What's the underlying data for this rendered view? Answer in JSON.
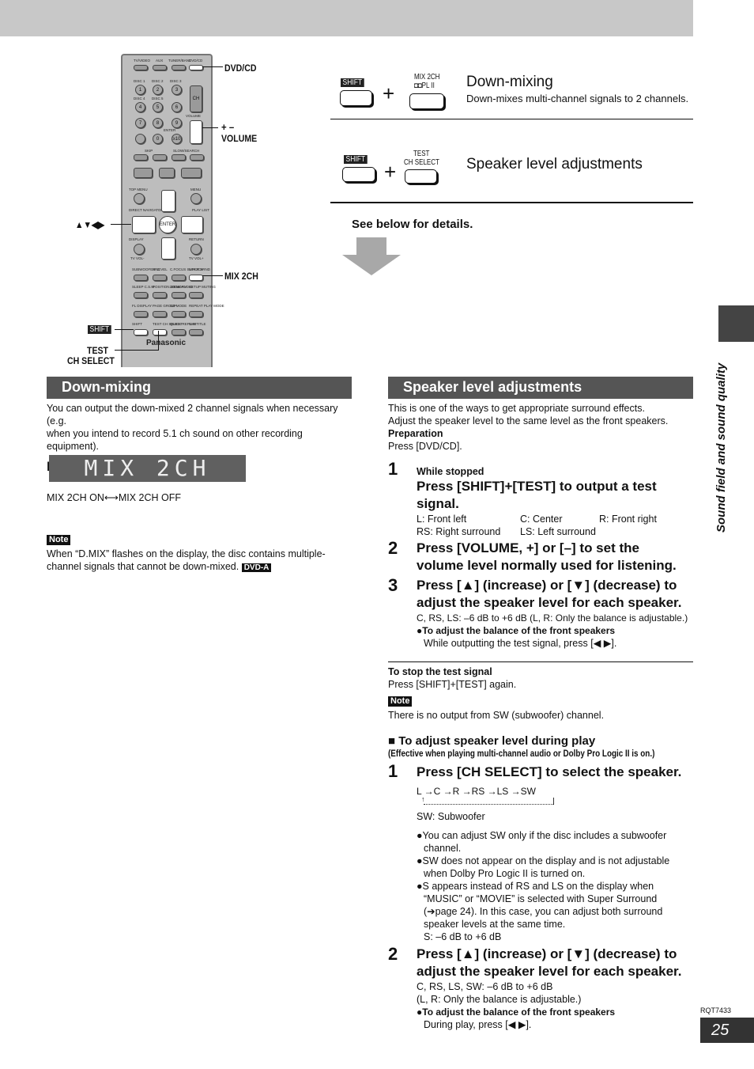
{
  "remote": {
    "labels": {
      "tvvideo": "TV/VIDEO",
      "aux": "AUX",
      "tuner": "TUNER/BAND",
      "dvdcd": "DVD/CD",
      "disc1": "DISC 1",
      "disc2": "DISC 2",
      "disc3": "DISC 3",
      "disc4": "DISC 4",
      "disc5": "DISC 5",
      "n1": "1",
      "n2": "2",
      "n3": "3",
      "n4": "4",
      "n5": "5",
      "n6": "6",
      "n7": "7",
      "n8": "8",
      "n9": "9",
      "cancel": "CANCEL",
      "n0": "0",
      "n10": "≥10",
      "ch": "CH",
      "volume": "VOLUME",
      "enter": "ENTER",
      "skip": "SKIP",
      "slow": "SLOW/SEARCH",
      "topmenu": "TOP MENU",
      "menu": "MENU",
      "direct": "DIRECT NAVIGATOR",
      "play": "PLAY LIST",
      "display": "DISPLAY",
      "return": "RETURN",
      "tvvolm": "TV VOL-",
      "tvvolp": "TV VOL+",
      "subwoofer": "SUBWOOFER LEVEL",
      "sfc": "SFC",
      "cfocus": "C.FOCUS SUPER SRND",
      "mix2ch": "MIX 2CH",
      "sleep": "SLEEP C.S.M",
      "position": "POSITION MEMORY",
      "zoom": "ZOOM AUDIO",
      "setup": "SETUP MUTING",
      "fldisplay": "FL DISPLAY",
      "page": "PAGE GROUP",
      "cdmode": "CD MODE",
      "repeat": "REPEAT PLAY MODE",
      "shift": "SHIFT",
      "test": "TEST CH SELECT",
      "quick": "QUICK REPLAY",
      "subtitle": "SUBTITLE",
      "brand": "Panasonic"
    },
    "callouts": {
      "dvdcd": "DVD/CD",
      "plusminus": "+ –",
      "volume": "VOLUME",
      "arrows": "▲▼◀▶",
      "mix2ch": "MIX 2CH",
      "shift": "SHIFT",
      "test": "TEST",
      "chselect": "CH SELECT"
    }
  },
  "summary": {
    "row1": {
      "shift": "SHIFT",
      "key_top": "MIX 2CH",
      "key_bottom": "◘◘PL II",
      "plus": "+",
      "title": "Down-mixing",
      "desc": "Down-mixes multi-channel signals to 2 channels."
    },
    "row2": {
      "shift": "SHIFT",
      "key_top": "TEST",
      "key_bottom": "CH SELECT",
      "plus": "+",
      "title": "Speaker level adjustments"
    },
    "see_below": "See below for details."
  },
  "side_tab": "Sound field and sound quality",
  "downmix": {
    "heading": "Down-mixing",
    "intro": [
      "You can output the down-mixed 2 channel signals when necessary (e.g.",
      "when you intend to record 5.1 ch sound on other recording equipment)."
    ],
    "press": "Press [SHIFT]+[MIX 2CH].",
    "display": "MIX 2CH",
    "toggle": "MIX 2CH ON⟷MIX 2CH OFF",
    "note_label": "Note",
    "note": [
      "When “D.MIX” flashes on the display, the disc contains multiple-",
      "channel signals that cannot be down-mixed."
    ],
    "badge": "DVD-A"
  },
  "speaker": {
    "heading": "Speaker level adjustments",
    "intro": [
      "This is one of the ways to get appropriate surround effects.",
      "Adjust the speaker level to the same level as the front speakers."
    ],
    "prep_label": "Preparation",
    "prep": "Press [DVD/CD].",
    "steps": [
      {
        "num": "1",
        "pre": "While stopped",
        "title": [
          "Press [SHIFT]+[TEST] to output a test",
          "signal."
        ],
        "legend": [
          [
            "L:  Front left",
            "C:  Center",
            "R:  Front right"
          ],
          [
            "RS:  Right surround",
            "LS:  Left surround",
            ""
          ]
        ]
      },
      {
        "num": "2",
        "title": [
          "Press [VOLUME, +] or [–] to set the",
          "volume level normally used for listening."
        ]
      },
      {
        "num": "3",
        "title": [
          "Press [▲] (increase) or [▼] (decrease) to",
          "adjust the speaker level for each speaker."
        ],
        "range": "C, RS, LS:  –6 dB to +6 dB (L, R: Only the balance is adjustable.)",
        "bullet": "●To adjust the balance of the front speakers",
        "bullet_text": "While outputting the test signal, press [◀ ▶]."
      }
    ],
    "stop_label": "To stop the test signal",
    "stop": "Press [SHIFT]+[TEST] again.",
    "note_label": "Note",
    "note": "There is no output from SW (subwoofer) channel.",
    "play": {
      "heading": "■ To adjust speaker level during play",
      "sub": "(Effective when playing multi-channel audio or Dolby Pro Logic II is on.)",
      "step1": {
        "num": "1",
        "title": "Press [CH SELECT] to select the speaker.",
        "sequence": "L →C →R →RS →LS →SW",
        "sw": "SW: Subwoofer",
        "bullets": [
          [
            "●You can adjust SW only if the disc includes a subwoofer",
            "channel."
          ],
          [
            "●SW does not appear on the display and is not adjustable",
            "when Dolby Pro Logic II is turned on."
          ],
          [
            "●S appears instead of RS and LS on the display when",
            "“MUSIC” or “MOVIE” is selected with Super Surround",
            "(➔page 24). In this case, you can adjust both surround",
            "speaker levels at the same time.",
            "S:  –6 dB to +6 dB"
          ]
        ]
      },
      "step2": {
        "num": "2",
        "title": [
          "Press [▲] (increase) or [▼] (decrease) to",
          "adjust the speaker level for each speaker."
        ],
        "lines": [
          "C, RS, LS, SW:  –6 dB to +6 dB",
          "(L, R: Only the balance is adjustable.)"
        ],
        "bullet": "●To adjust the balance of the front speakers",
        "bullet_text": "During play, press [◀ ▶]."
      }
    }
  },
  "footer": {
    "code": "RQT7433",
    "page": "25"
  },
  "colors": {
    "header_bg": "#555555",
    "topbar": "#c8c8c8",
    "side_tab": "#444444",
    "display_bg": "#606060"
  }
}
